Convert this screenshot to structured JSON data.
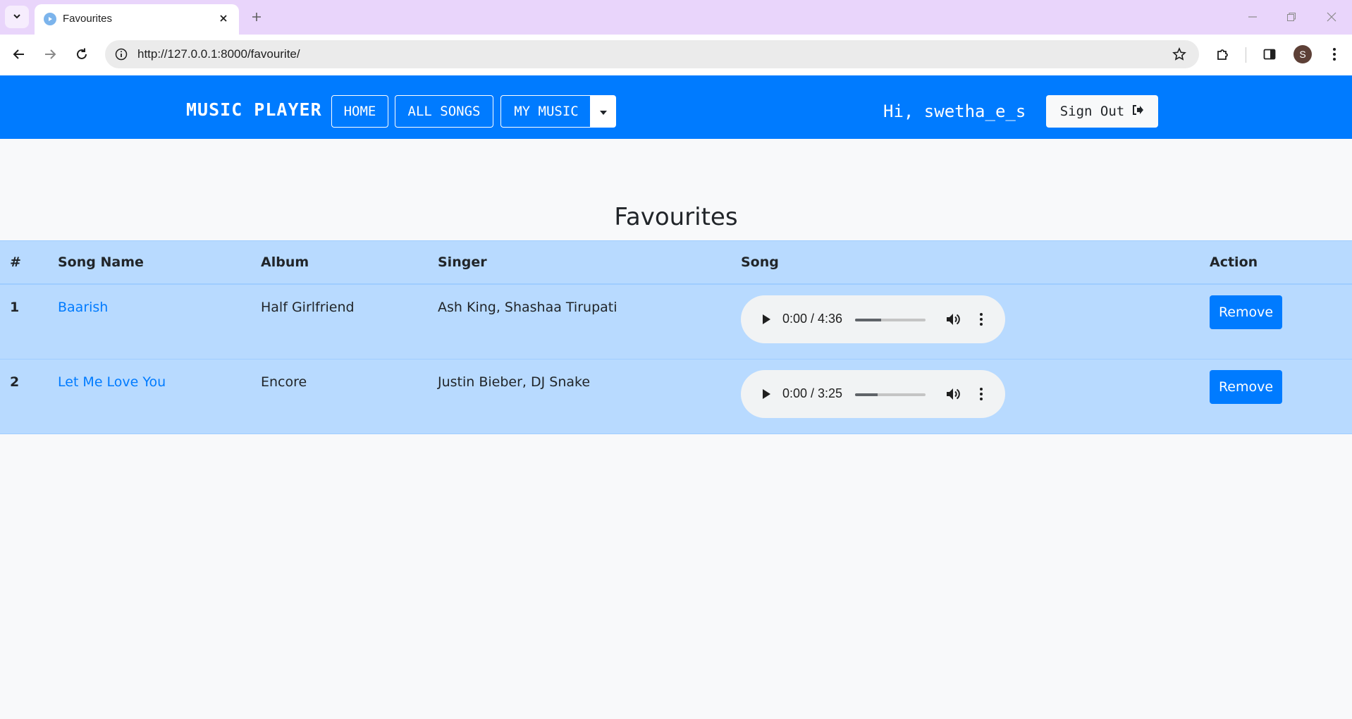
{
  "browser": {
    "tab_title": "Favourites",
    "url": "http://127.0.0.1:8000/favourite/",
    "profile_initial": "S"
  },
  "navbar": {
    "brand": "MUSIC PLAYER",
    "home_label": "HOME",
    "all_songs_label": "ALL SONGS",
    "my_music_label": "MY MUSIC",
    "greeting": "Hi, swetha_e_s",
    "signout_label": "Sign Out"
  },
  "page": {
    "title": "Favourites"
  },
  "table": {
    "headers": [
      "#",
      "Song Name",
      "Album",
      "Singer",
      "Song",
      "Action"
    ],
    "rows": [
      {
        "num": "1",
        "song": "Baarish",
        "album": "Half Girlfriend",
        "singer": "Ash King, Shashaa Tirupati",
        "time": "0:00 / 4:36",
        "volume": 0.37,
        "action": "Remove"
      },
      {
        "num": "2",
        "song": "Let Me Love You",
        "album": "Encore",
        "singer": "Justin Bieber, DJ Snake",
        "time": "0:00 / 3:25",
        "volume": 0.32,
        "action": "Remove"
      }
    ]
  },
  "colors": {
    "primary": "#007bff",
    "table_bg": "#b8daff",
    "tab_strip": "#e9d5fb"
  }
}
